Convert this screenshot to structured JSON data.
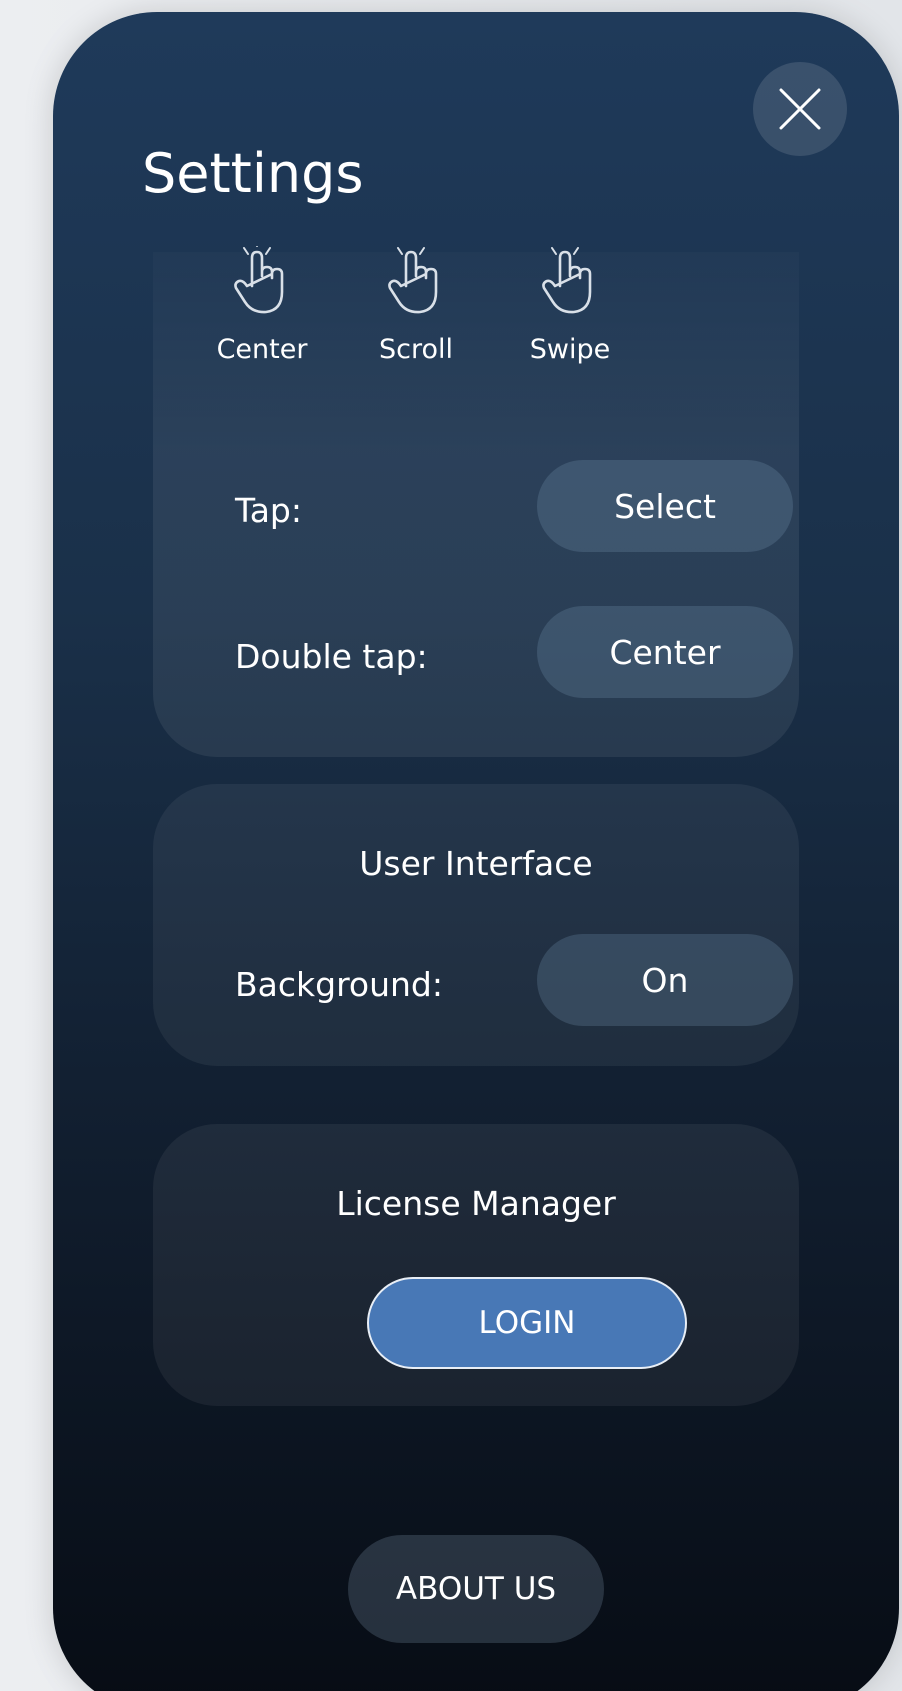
{
  "header": {
    "title": "Settings"
  },
  "gestures": [
    {
      "label": "Center",
      "icon": "hand-pointer-icon"
    },
    {
      "label": "Scroll",
      "icon": "hand-pointer-icon"
    },
    {
      "label": "Swipe",
      "icon": "hand-pointer-icon"
    }
  ],
  "controls": {
    "tap_label": "Tap:",
    "tap_value": "Select",
    "double_tap_label": "Double tap:",
    "double_tap_value": "Center"
  },
  "user_interface": {
    "title": "User Interface",
    "background_label": "Background:",
    "background_value": "On"
  },
  "license_manager": {
    "title": "License Manager",
    "login_label": "LOGIN"
  },
  "footer": {
    "about_label": "ABOUT US"
  },
  "colors": {
    "accent": "#4878b6",
    "panel_top": "#1f3a5a",
    "panel_bottom": "#070c14"
  }
}
